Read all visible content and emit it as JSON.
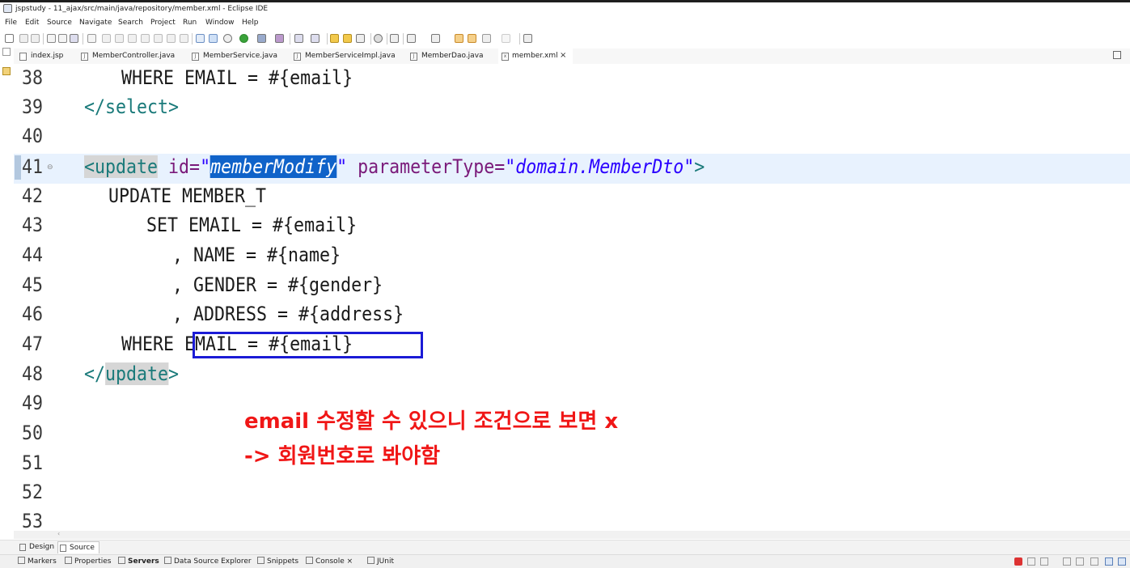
{
  "window": {
    "title": "jspstudy - 11_ajax/src/main/java/repository/member.xml - Eclipse IDE"
  },
  "menu": [
    "File",
    "Edit",
    "Source",
    "Navigate",
    "Search",
    "Project",
    "Run",
    "Window",
    "Help"
  ],
  "tabs": [
    {
      "label": "index.jsp",
      "icon": "jsp-file-icon"
    },
    {
      "label": "MemberController.java",
      "icon": "java-file-icon"
    },
    {
      "label": "MemberService.java",
      "icon": "java-file-icon"
    },
    {
      "label": "MemberServiceImpl.java",
      "icon": "java-file-icon"
    },
    {
      "label": "MemberDao.java",
      "icon": "java-file-icon"
    },
    {
      "label": "member.xml",
      "icon": "xml-file-icon",
      "active": true
    }
  ],
  "tab_close": "×",
  "editor": {
    "line_numbers": [
      "38",
      "39",
      "40",
      "41",
      "42",
      "43",
      "44",
      "45",
      "46",
      "47",
      "48",
      "49",
      "50",
      "51",
      "52",
      "53"
    ],
    "fold_marker": "⊖",
    "lines": {
      "l38": {
        "indent": "    ",
        "text": "WHERE EMAIL = #{email}"
      },
      "l39": {
        "tag": "</select>"
      },
      "l41": {
        "open": "<update",
        "attr1": "id=",
        "q1": "\"",
        "selected": "memberModify",
        "q2": "\"",
        "attr2": "parameterType=",
        "val2": "\"domain.MemberDto\"",
        "close": ">"
      },
      "l42": {
        "text": "UPDATE MEMBER_T"
      },
      "l43": {
        "text": "SET EMAIL = #{email}"
      },
      "l44": {
        "text": ", NAME = #{name}"
      },
      "l45": {
        "text": ", GENDER = #{gender}"
      },
      "l46": {
        "text": ", ADDRESS = #{address}"
      },
      "l47": {
        "kw": "WHERE",
        "rest": "EMAIL = #{email}"
      },
      "l48": {
        "lt": "</",
        "tagname": "update",
        "gt": ">"
      }
    }
  },
  "annotation": {
    "line1": "email 수정할 수 있으니 조건으로 보면 x",
    "line2": "-> 회원번호로 봐야함",
    "color": "#f01616"
  },
  "editor_bottom_tabs": [
    "Design",
    "Source"
  ],
  "views_bar": [
    "Markers",
    "Properties",
    "Servers",
    "Data Source Explorer",
    "Snippets",
    "Console",
    "JUnit"
  ],
  "views_bar_console_close": "×",
  "colors": {
    "selection": "#1063c9",
    "current_line": "#e8f2fe",
    "tag": "#1a7a7a",
    "attr": "#7a1a7a",
    "attr_value": "#2a00ff",
    "highlight_box": "#1b1bd6"
  }
}
